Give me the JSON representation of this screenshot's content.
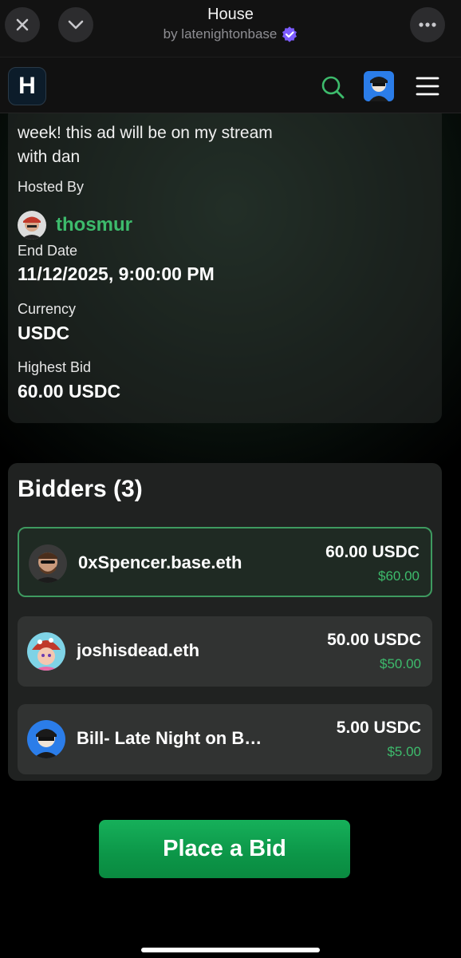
{
  "miniapp": {
    "title": "House",
    "subtitle": "by latenightonbase"
  },
  "header": {
    "logo_letter": "H"
  },
  "detail": {
    "description": "week! this ad will be on my stream with dan",
    "hosted_by_label": "Hosted By",
    "host_name": "thosmur",
    "end_date_label": "End Date",
    "end_date": "11/12/2025, 9:00:00 PM",
    "currency_label": "Currency",
    "currency": "USDC",
    "highest_bid_label": "Highest Bid",
    "highest_bid": "60.00 USDC"
  },
  "bidders": {
    "title": "Bidders (3)",
    "rows": [
      {
        "name": "0xSpencer.base.eth",
        "amount": "60.00 USDC",
        "usd": "$60.00"
      },
      {
        "name": "joshisdead.eth",
        "amount": "50.00 USDC",
        "usd": "$50.00"
      },
      {
        "name": "Bill- Late Night on Base",
        "amount": "5.00 USDC",
        "usd": "$5.00"
      }
    ]
  },
  "cta": {
    "label": "Place a Bid"
  },
  "colors": {
    "accent_green": "#3dbb6c",
    "button_green": "#0c9648",
    "verified_purple": "#7c5cff"
  },
  "icons": [
    "close-icon",
    "chevron-down-icon",
    "more-icon",
    "verified-icon",
    "search-icon",
    "menu-icon"
  ]
}
